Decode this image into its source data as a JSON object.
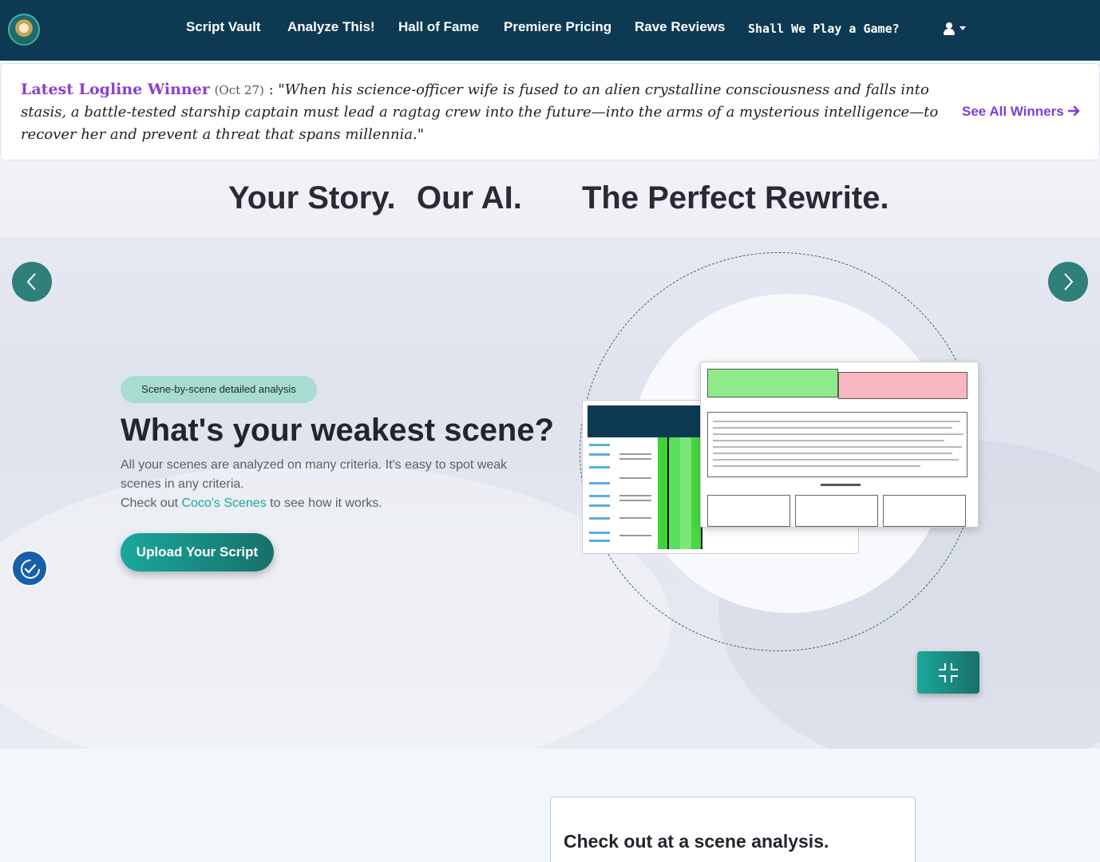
{
  "nav": {
    "items": [
      {
        "label": "Script Vault"
      },
      {
        "label": "Analyze This!"
      },
      {
        "label": "Hall of Fame"
      },
      {
        "label": "Premiere Pricing"
      },
      {
        "label": "Rave Reviews"
      },
      {
        "label": "Shall We Play a Game?"
      }
    ]
  },
  "logline": {
    "title": "Latest Logline Winner",
    "date": "(Oct 27)",
    "separator": " : ",
    "quote": "\"When his science-officer wife is fused to an alien crystalline consciousness and falls into stasis, a battle-tested starship captain must lead a ragtag crew into the future—into the arms of a mysterious intelligence—to recover her and prevent a threat that spans millennia.\"",
    "see_all": "See All Winners"
  },
  "hero": {
    "tagline": [
      "Your Story.",
      "Our AI.",
      "The Perfect Rewrite."
    ],
    "badge": "Scene-by-scene detailed analysis",
    "headline": "What's your weakest scene?",
    "desc_line1": "All your scenes are analyzed on many criteria. It's easy to spot weak scenes in any criteria.",
    "desc_pre": "Check out ",
    "desc_link": "Coco's Scenes",
    "desc_post": " to see how it works.",
    "upload": "Upload Your Script"
  },
  "lower": {
    "card_title": "Check out at a scene analysis."
  },
  "colors": {
    "navbar": "#0d3a52",
    "accent_teal": "#1aa89a",
    "accent_purple": "#8a3fd1"
  },
  "icons": [
    "logo",
    "user-icon",
    "caret-down-icon",
    "arrow-right-icon",
    "chevron-left-icon",
    "chevron-right-icon",
    "accessibility-icon",
    "compress-icon"
  ]
}
